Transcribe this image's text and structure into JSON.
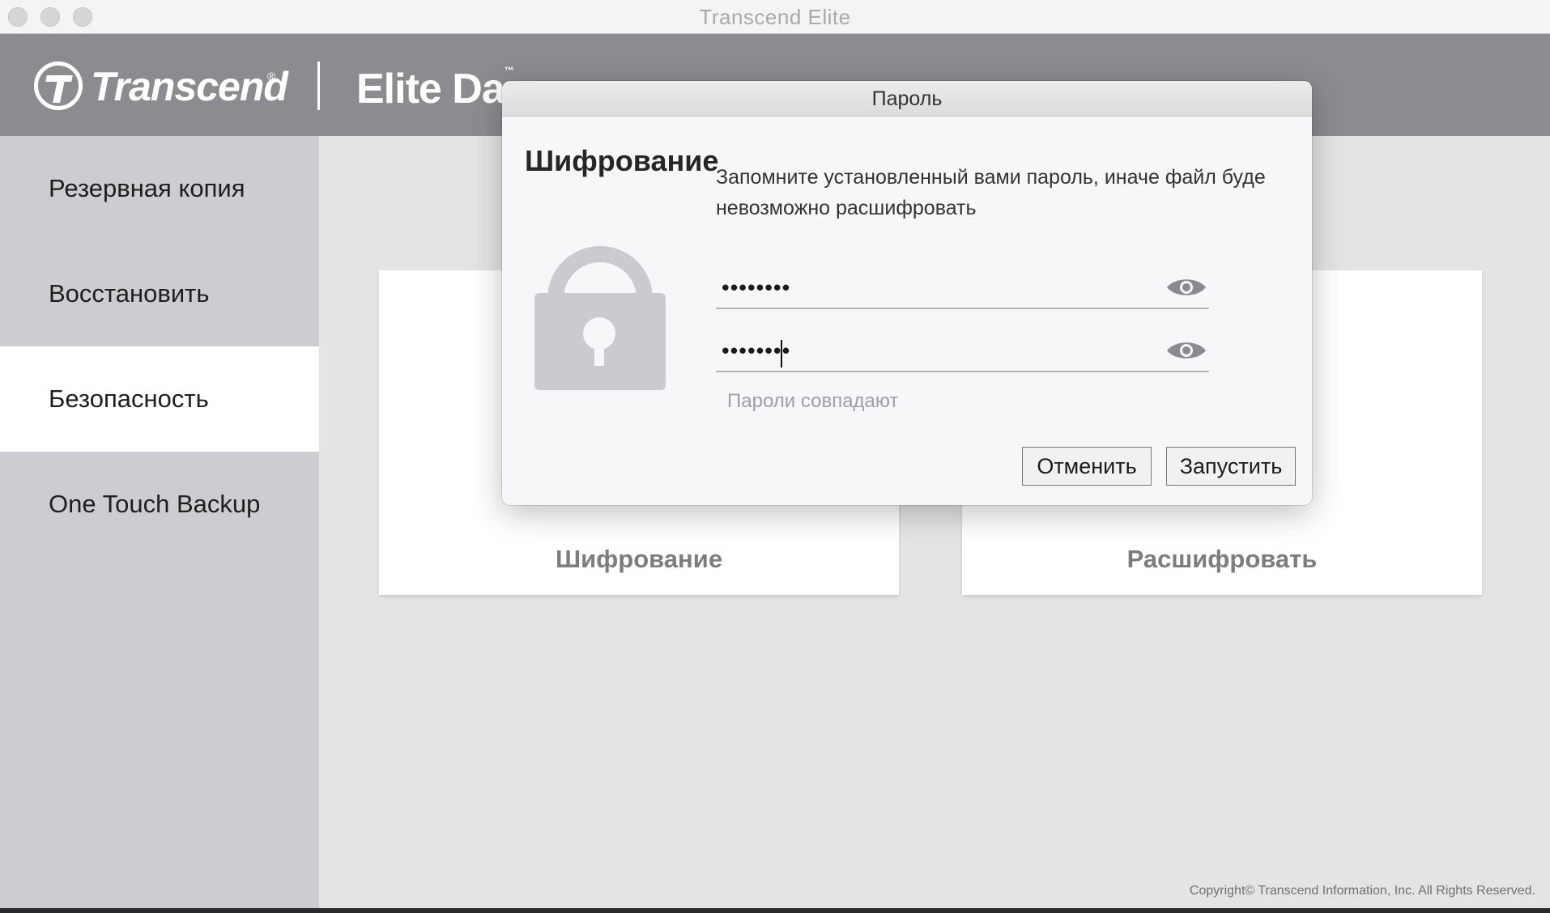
{
  "window": {
    "title": "Transcend Elite"
  },
  "header": {
    "logo_text": "Transcend",
    "logo_reg": "®",
    "product_text": "Elite Da",
    "product_tm": "™"
  },
  "sidebar": {
    "items": [
      {
        "label": "Резервная копия"
      },
      {
        "label": "Восстановить"
      },
      {
        "label": "Безопасность"
      },
      {
        "label": "One Touch Backup"
      }
    ]
  },
  "main": {
    "cards": [
      {
        "label": "Шифрование"
      },
      {
        "label": "Расшифровать"
      }
    ],
    "copyright": "Copyright© Transcend Information, Inc. All Rights Reserved."
  },
  "dialog": {
    "title": "Пароль",
    "heading": "Шифрование",
    "message_line1": "Запомните установленный вами пароль, иначе файл буде",
    "message_line2": "невозможно расшифровать",
    "password_value": "••••••••",
    "confirm_value": "••••••••",
    "match_text": "Пароли совпадают",
    "cancel_label": "Отменить",
    "start_label": "Запустить"
  }
}
